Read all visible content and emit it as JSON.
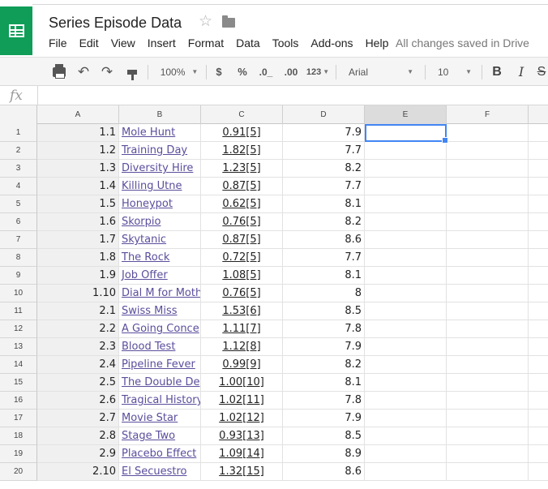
{
  "app": {
    "doc_title": "Series Episode Data",
    "save_status": "All changes saved in Drive"
  },
  "menu": [
    "File",
    "Edit",
    "View",
    "Insert",
    "Format",
    "Data",
    "Tools",
    "Add-ons",
    "Help"
  ],
  "toolbar": {
    "zoom": "100%",
    "currency": "$",
    "percent": "%",
    "decrease_decimals": ".0_",
    "increase_decimals": ".00",
    "more_formats": "123",
    "font": "Arial",
    "font_size": "10",
    "bold": "B",
    "italic": "I",
    "strikethrough": "S"
  },
  "formula_bar": {
    "fx_label": "fx",
    "value": ""
  },
  "columns": [
    "A",
    "B",
    "C",
    "D",
    "E",
    "F"
  ],
  "selected_cell": "E1",
  "rows": [
    {
      "n": "1",
      "a": "1.1",
      "b": "Mole Hunt",
      "c": "0.91[5]",
      "d": "7.9"
    },
    {
      "n": "2",
      "a": "1.2",
      "b": "Training Day",
      "c": "1.82[5]",
      "d": "7.7"
    },
    {
      "n": "3",
      "a": "1.3",
      "b": "Diversity Hire",
      "c": "1.23[5]",
      "d": "8.2"
    },
    {
      "n": "4",
      "a": "1.4",
      "b": "Killing Utne",
      "c": "0.87[5]",
      "d": "7.7"
    },
    {
      "n": "5",
      "a": "1.5",
      "b": "Honeypot",
      "c": "0.62[5]",
      "d": "8.1"
    },
    {
      "n": "6",
      "a": "1.6",
      "b": "Skorpio",
      "c": "0.76[5]",
      "d": "8.2"
    },
    {
      "n": "7",
      "a": "1.7",
      "b": "Skytanic",
      "c": "0.87[5]",
      "d": "8.6"
    },
    {
      "n": "8",
      "a": "1.8",
      "b": "The Rock",
      "c": "0.72[5]",
      "d": "7.7"
    },
    {
      "n": "9",
      "a": "1.9",
      "b": "Job Offer",
      "c": "1.08[5]",
      "d": "8.1"
    },
    {
      "n": "10",
      "a": "1.10",
      "b": "Dial M for Moth",
      "c": "0.76[5]",
      "d": "8"
    },
    {
      "n": "11",
      "a": "2.1",
      "b": "Swiss Miss",
      "c": "1.53[6]",
      "d": "8.5"
    },
    {
      "n": "12",
      "a": "2.2",
      "b": "A Going Conce",
      "c": "1.11[7]",
      "d": "7.8"
    },
    {
      "n": "13",
      "a": "2.3",
      "b": "Blood Test",
      "c": "1.12[8]",
      "d": "7.9"
    },
    {
      "n": "14",
      "a": "2.4",
      "b": "Pipeline Fever",
      "c": "0.99[9]",
      "d": "8.2"
    },
    {
      "n": "15",
      "a": "2.5",
      "b": "The Double De",
      "c": "1.00[10]",
      "d": "8.1"
    },
    {
      "n": "16",
      "a": "2.6",
      "b": "Tragical History",
      "c": "1.02[11]",
      "d": "7.8"
    },
    {
      "n": "17",
      "a": "2.7",
      "b": "Movie Star",
      "c": "1.02[12]",
      "d": "7.9"
    },
    {
      "n": "18",
      "a": "2.8",
      "b": "Stage Two",
      "c": "0.93[13]",
      "d": "8.5"
    },
    {
      "n": "19",
      "a": "2.9",
      "b": "Placebo Effect",
      "c": "1.09[14]",
      "d": "8.9"
    },
    {
      "n": "20",
      "a": "2.10",
      "b": "El Secuestro",
      "c": "1.32[15]",
      "d": "8.6"
    }
  ]
}
